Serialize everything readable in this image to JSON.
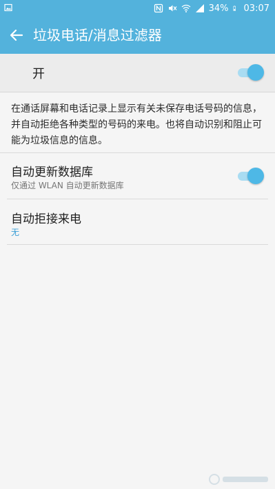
{
  "status_bar": {
    "battery_percent": "34%",
    "time": "03:07",
    "icons": [
      "gallery-icon",
      "nfc-icon",
      "mute-icon",
      "wifi-icon",
      "signal-icon",
      "battery-icon"
    ]
  },
  "app_bar": {
    "title": "垃圾电话/消息过滤器",
    "back_icon": "arrow-left-icon"
  },
  "master_switch": {
    "label": "开",
    "state": "on"
  },
  "description": "在通话屏幕和电话记录上显示有关未保存电话号码的信息，并自动拒绝各种类型的号码的来电。也将自动识别和阻止可能为垃圾信息的信息。",
  "settings": [
    {
      "title": "自动更新数据库",
      "subtitle": "仅通过 WLAN 自动更新数据库",
      "switch": "on"
    },
    {
      "title": "自动拒接来电",
      "subtitle": "无"
    }
  ],
  "colors": {
    "accent": "#53b2dc",
    "switch_on": "#4eb8e6",
    "link_value": "#3a9fd6"
  }
}
